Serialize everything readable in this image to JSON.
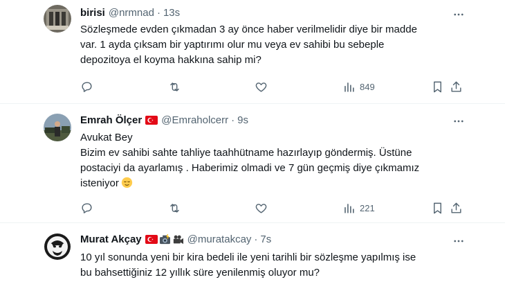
{
  "tweets": [
    {
      "name": "birisi",
      "handle": "@nrmnad",
      "dot": "·",
      "time": "13s",
      "lines": [
        "Sözleşmede evden çıkmadan 3 ay önce haber verilmelidir diye bir madde",
        "var. 1 ayda çıksam bir yaptırımı olur mu veya ev sahibi bu sebeple",
        "depozitoya el koyma hakkına sahip mi?"
      ],
      "views": "849"
    },
    {
      "name": "Emrah Ölçer",
      "handle": "@Emraholcerr",
      "dot": "·",
      "time": "9s",
      "lines": [
        "Avukat Bey",
        "Bizim ev sahibi sahte tahliye taahhütname hazırlayıp göndermiş. Üstüne",
        "postaciyi da ayarlamış . Haberimiz olmadi ve 7 gün geçmiş diye çıkmamız",
        "isteniyor"
      ],
      "views": "221"
    },
    {
      "name": "Murat Akçay",
      "handle": "@muratakcay",
      "dot": "·",
      "time": "7s",
      "lines": [
        "10 yıl sonunda yeni bir kira bedeli ile yeni tarihli bir sözleşme yapılmış ise",
        "bu bahsettiğiniz 12 yıllık süre yenilenmiş oluyor mu?"
      ]
    }
  ],
  "icons": {
    "more": "more-horizontal-icon",
    "reply": "reply-icon",
    "retweet": "retweet-icon",
    "like": "heart-icon",
    "views": "views-chart-icon",
    "bookmark": "bookmark-icon",
    "share": "share-icon"
  },
  "colors": {
    "text": "#0f1419",
    "secondary": "#536471",
    "divider": "#eff3f4",
    "flag_red": "#e30a17"
  }
}
